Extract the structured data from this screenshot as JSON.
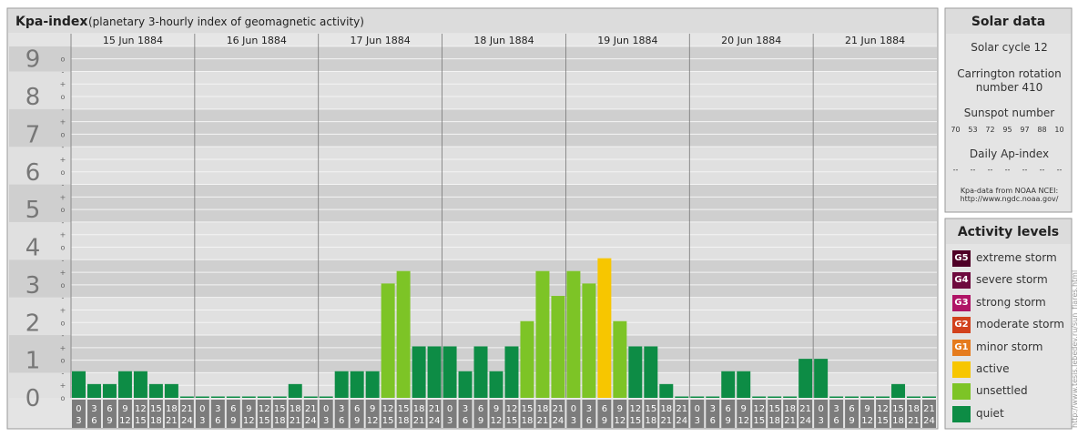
{
  "chart_data": {
    "type": "bar",
    "title": "Kpa-index",
    "subtitle": "(planetary 3-hourly index of geomagnetic activity)",
    "days": [
      "15 Jun 1884",
      "16 Jun 1884",
      "17 Jun 1884",
      "18 Jun 1884",
      "19 Jun 1884",
      "20 Jun 1884",
      "21 Jun 1884"
    ],
    "hour_labels": [
      [
        "0",
        "3"
      ],
      [
        "3",
        "6"
      ],
      [
        "6",
        "9"
      ],
      [
        "9",
        "12"
      ],
      [
        "12",
        "15"
      ],
      [
        "15",
        "18"
      ],
      [
        "18",
        "21"
      ],
      [
        "21",
        "24"
      ]
    ],
    "y_major_labels": [
      "0",
      "1",
      "2",
      "3",
      "4",
      "5",
      "6",
      "7",
      "8",
      "9"
    ],
    "y_minor_labels": [
      "o",
      "+",
      "-"
    ],
    "ylim": [
      0,
      9.33
    ],
    "values": [
      0.67,
      0.33,
      0.33,
      0.67,
      0.67,
      0.33,
      0.33,
      0,
      0,
      0,
      0,
      0,
      0,
      0,
      0.33,
      0,
      0,
      0.67,
      0.67,
      0.67,
      3,
      3.33,
      1.33,
      1.33,
      1.33,
      0.67,
      1.33,
      0.67,
      1.33,
      2,
      3.33,
      2.67,
      3.33,
      3,
      3.67,
      2,
      1.33,
      1.33,
      0.33,
      0,
      0,
      0,
      0.67,
      0.67,
      0,
      0,
      0,
      1,
      1,
      0,
      0,
      0,
      0,
      0.33,
      0,
      0
    ]
  },
  "solar": {
    "title": "Solar data",
    "cycle": "Solar cycle 12",
    "carrington_line1": "Carrington rotation",
    "carrington_line2": "number 410",
    "sunspot_title": "Sunspot number",
    "sunspots": [
      "70",
      "53",
      "72",
      "95",
      "97",
      "88",
      "10"
    ],
    "ap_title": "Daily Ap-index",
    "ap_values": [
      "--",
      "--",
      "--",
      "--",
      "--",
      "--",
      "--"
    ],
    "source_line1": "Kpa-data from NOAA NCEI:",
    "source_line2": "http://www.ngdc.noaa.gov/"
  },
  "activity": {
    "title": "Activity levels",
    "levels": [
      {
        "badge": "G5",
        "label": "extreme storm",
        "color": "#4f0026"
      },
      {
        "badge": "G4",
        "label": "severe storm",
        "color": "#6e0a3e"
      },
      {
        "badge": "G3",
        "label": "strong storm",
        "color": "#b01466"
      },
      {
        "badge": "G2",
        "label": "moderate storm",
        "color": "#d2411c"
      },
      {
        "badge": "G1",
        "label": "minor storm",
        "color": "#e57b1d"
      },
      {
        "badge": "",
        "label": "active",
        "color": "#f7c600"
      },
      {
        "badge": "",
        "label": "unsettled",
        "color": "#7dc426"
      },
      {
        "badge": "",
        "label": "quiet",
        "color": "#0d8c45"
      }
    ]
  },
  "colors": {
    "quiet": "#0d8c45",
    "unsettled": "#7dc426",
    "active": "#f7c600"
  },
  "credit": "http://www.tesis.lebedev.ru/sun_flares.html"
}
